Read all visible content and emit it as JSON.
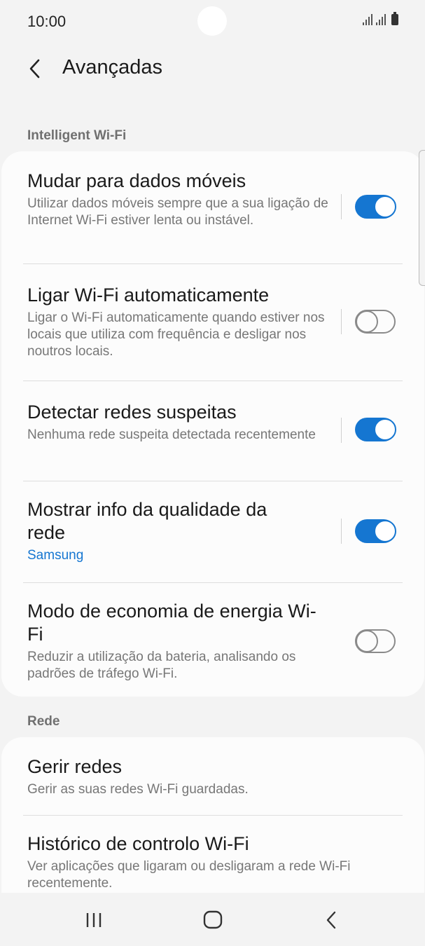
{
  "status_bar": {
    "time": "10:00"
  },
  "header": {
    "title": "Avançadas"
  },
  "sections": {
    "intelligent_wifi": "Intelligent Wi-Fi",
    "network": "Rede"
  },
  "settings": [
    {
      "title": "Mudar para dados móveis",
      "description": "Utilizar dados móveis sempre que a sua ligação de Internet Wi-Fi estiver lenta ou instável.",
      "toggle": "on"
    },
    {
      "title": "Ligar Wi-Fi automaticamente",
      "description": "Ligar o Wi-Fi automaticamente quando estiver nos locais que utiliza com frequência e desligar nos noutros locais.",
      "toggle": "off"
    },
    {
      "title": "Detectar redes suspeitas",
      "description": "Nenhuma rede suspeita detectada recentemente",
      "toggle": "on"
    },
    {
      "title": "Mostrar info da qualidade da rede",
      "description": "Samsung",
      "toggle": "on"
    },
    {
      "title": "Modo de economia de energia Wi-Fi",
      "description": "Reduzir a utilização da bateria, analisando os padrões de tráfego Wi-Fi.",
      "toggle": "off"
    }
  ],
  "network_items": [
    {
      "title": "Gerir redes",
      "description": "Gerir as suas redes Wi-Fi guardadas."
    },
    {
      "title": "Histórico de controlo Wi-Fi",
      "description": "Ver aplicações que ligaram ou desligaram a rede Wi-Fi recentemente."
    }
  ],
  "colors": {
    "accent": "#1576d1",
    "background": "#f3f3f3",
    "card": "#fcfcfc"
  },
  "icons": [
    "back-arrow-icon",
    "recent-apps-icon",
    "home-icon",
    "back-icon"
  ]
}
